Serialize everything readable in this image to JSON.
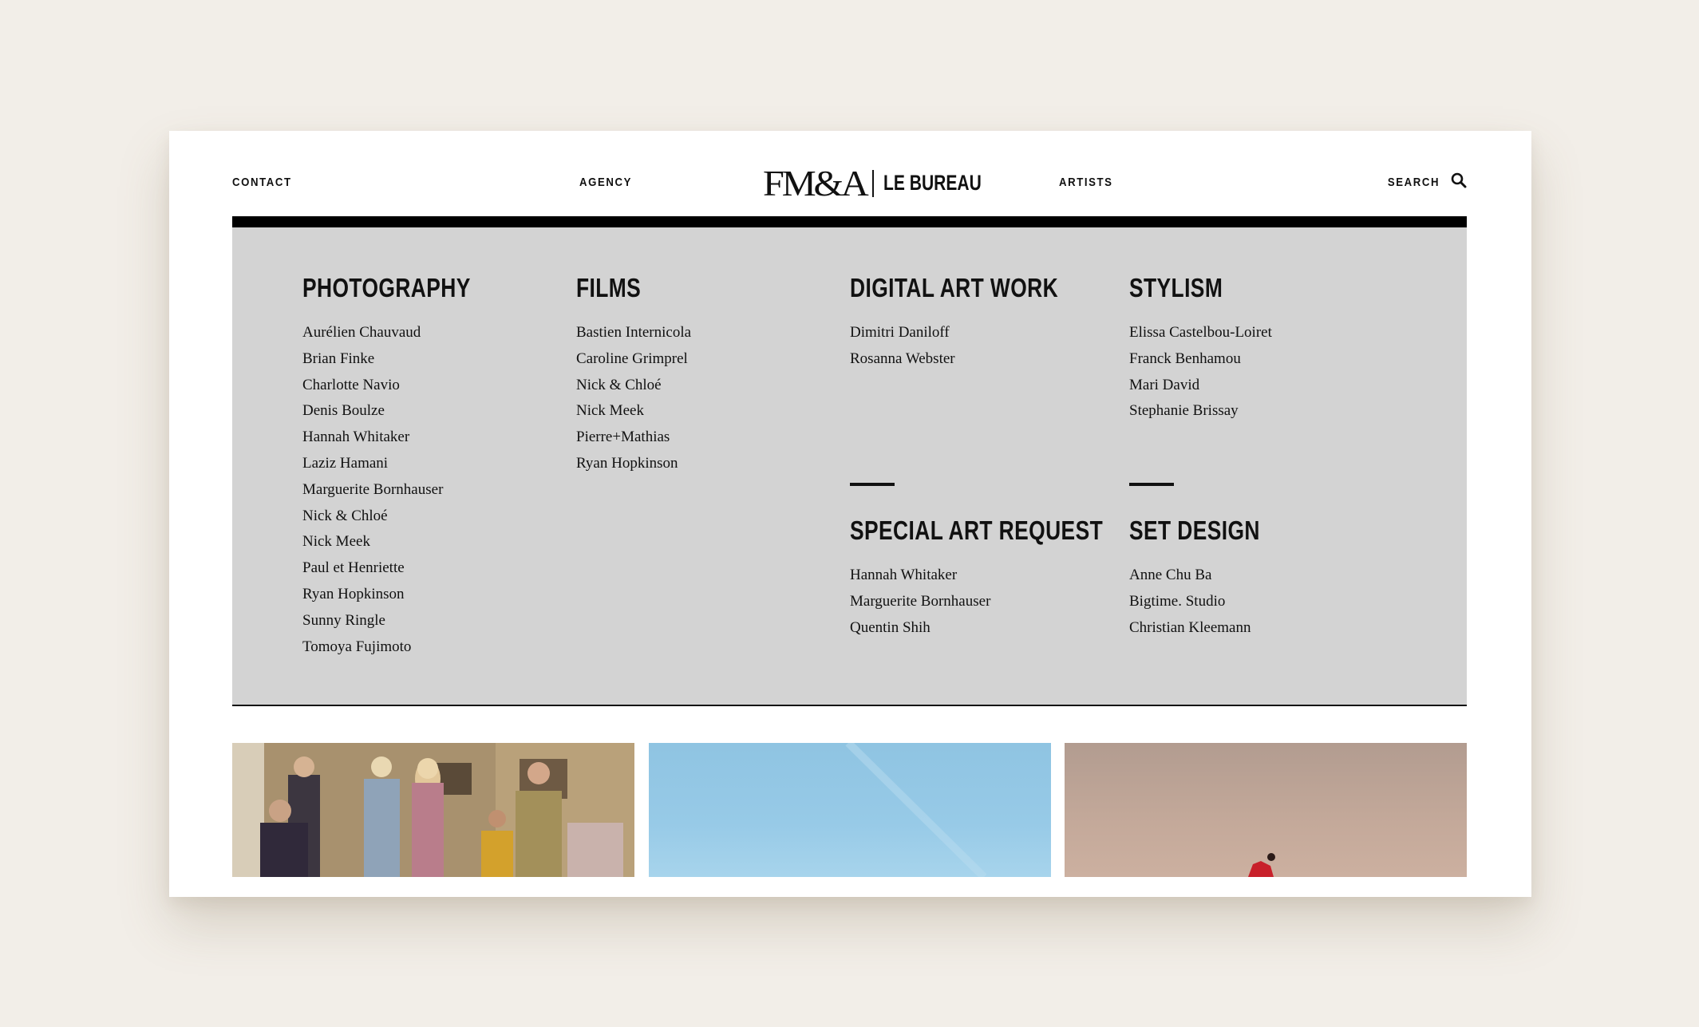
{
  "nav": {
    "contact": "CONTACT",
    "agency": "AGENCY",
    "artists": "ARTISTS",
    "search": "SEARCH"
  },
  "logo": {
    "mark": "FM&A",
    "sub": "LE BUREAU"
  },
  "menu": {
    "photography": {
      "title": "PHOTOGRAPHY",
      "items": [
        "Aurélien Chauvaud",
        "Brian Finke",
        "Charlotte Navio",
        "Denis Boulze",
        "Hannah Whitaker",
        "Laziz Hamani",
        "Marguerite Bornhauser",
        "Nick & Chloé",
        "Nick Meek",
        "Paul et Henriette",
        "Ryan Hopkinson",
        "Sunny Ringle",
        "Tomoya Fujimoto"
      ]
    },
    "films": {
      "title": "FILMS",
      "items": [
        "Bastien Internicola",
        "Caroline Grimprel",
        "Nick & Chloé",
        "Nick Meek",
        "Pierre+Mathias",
        "Ryan Hopkinson"
      ]
    },
    "digital": {
      "title": "DIGITAL ART WORK",
      "items": [
        "Dimitri Daniloff",
        "Rosanna Webster"
      ]
    },
    "stylism": {
      "title": "STYLISM",
      "items": [
        "Elissa Castelbou-Loiret",
        "Franck Benhamou",
        "Mari David",
        "Stephanie Brissay"
      ]
    },
    "special": {
      "title": "SPECIAL ART REQUEST",
      "items": [
        "Hannah Whitaker",
        "Marguerite Bornhauser",
        "Quentin Shih"
      ]
    },
    "set_design": {
      "title": "SET DESIGN",
      "items": [
        "Anne Chu Ba",
        "Bigtime. Studio",
        "Christian Kleemann"
      ]
    }
  },
  "colors": {
    "page_bg": "#f2eee8",
    "card_bg": "#ffffff",
    "menu_bg": "#d3d3d3",
    "text": "#111111"
  }
}
